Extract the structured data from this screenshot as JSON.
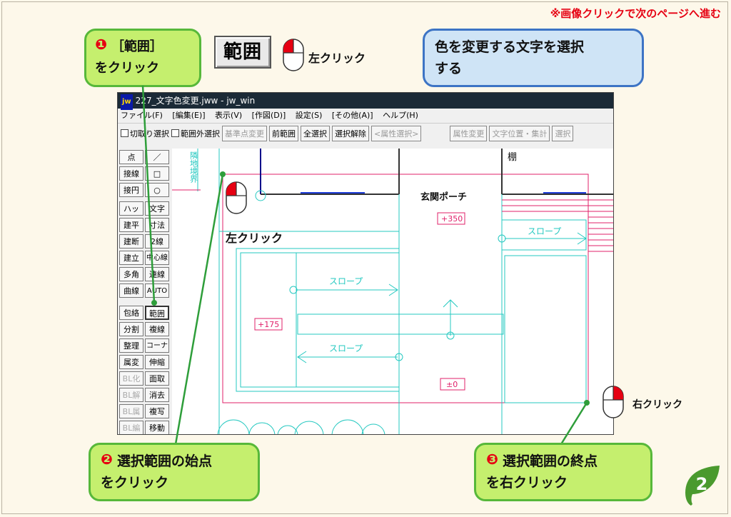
{
  "notice": "※画像クリックで次のページへ進む",
  "step1": {
    "num": "❶",
    "line1": "［範囲］",
    "line2": "をクリック"
  },
  "big_button": {
    "label": "範囲"
  },
  "mouse_labels": {
    "top": "左クリック",
    "canvas": "左クリック",
    "right": "右クリック"
  },
  "info": {
    "line1": "色を変更する文字を選択",
    "line2": "する"
  },
  "step2": {
    "num": "❷",
    "line1": "選択範囲の始点",
    "line2": "をクリック"
  },
  "step3": {
    "num": "❸",
    "line1": "選択範囲の終点",
    "line2": "を右クリック"
  },
  "page_number": "2",
  "colors": {
    "accent_red": "#e60012",
    "green": "#57b83a",
    "green_fill": "#c5ef6e",
    "blue": "#3d74c5",
    "blue_fill": "#cfe4f6",
    "cyan": "#24c8c0",
    "magenta": "#e0206a"
  },
  "window": {
    "logo": "jw",
    "title": "227_文字色変更.jww - jw_win",
    "menu": [
      "ファイル(F)",
      "[編集(E)]",
      "表示(V)",
      "[作図(D)]",
      "設定(S)",
      "[その他(A)]",
      "ヘルプ(H)"
    ],
    "toolbar": {
      "cut_select": "切取り選択",
      "out_of_range": "範囲外選択",
      "base_change": "基準点変更",
      "prev_range": "前範囲",
      "select_all": "全選択",
      "deselect": "選択解除",
      "attr_select": "<属性選択>",
      "attr_change": "属性変更",
      "text_pos": "文字位置・集計",
      "select_cut": "選択"
    },
    "tools_left": [
      "点",
      "接線",
      "接円",
      "ハッチ",
      "建平",
      "建断",
      "建立",
      "多角形",
      "曲線",
      "包絡",
      "分割",
      "整理",
      "属変",
      "BL化",
      "BL解",
      "BL属",
      "BL編"
    ],
    "tools_right": [
      "／",
      "□",
      "○",
      "文字",
      "寸法",
      "2線",
      "中心線",
      "連線",
      "AUTO",
      "範囲",
      "複線",
      "コーナー",
      "伸縮",
      "面取",
      "消去",
      "複写",
      "移動"
    ]
  },
  "drawing": {
    "entrance": "玄関ポーチ",
    "shelf": "棚",
    "boundary": "隣地境界",
    "level_350": "+350",
    "level_175": "+175",
    "level_0": "±0",
    "slope_1": "スロープ",
    "slope_2": "スロープ",
    "slope_3": "スロープ"
  }
}
